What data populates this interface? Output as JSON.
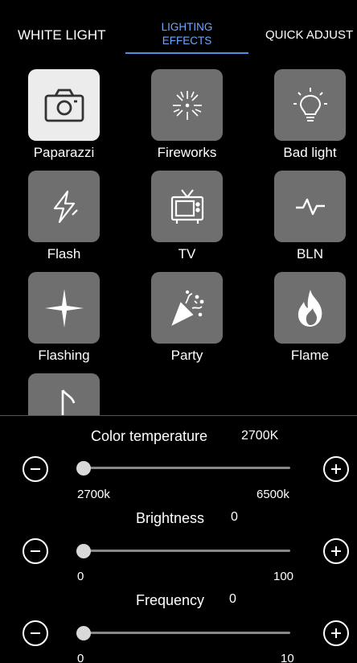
{
  "tabs": {
    "white_light": "WHITE LIGHT",
    "lighting_effects_line1": "LIGHTING",
    "lighting_effects_line2": "EFFECTS",
    "quick_adjust": "QUICK ADJUST",
    "active": "LIGHTING EFFECTS",
    "accent_color": "#4f8fe8"
  },
  "effects": [
    {
      "label": "Paparazzi",
      "icon": "camera-icon",
      "selected": true
    },
    {
      "label": "Fireworks",
      "icon": "fireworks-icon",
      "selected": false
    },
    {
      "label": "Bad light",
      "icon": "lightbulb-icon",
      "selected": false
    },
    {
      "label": "Flash",
      "icon": "lightning-icon",
      "selected": false
    },
    {
      "label": "TV",
      "icon": "tv-icon",
      "selected": false
    },
    {
      "label": "BLN",
      "icon": "pulse-icon",
      "selected": false
    },
    {
      "label": "Flashing",
      "icon": "sparkle-star-icon",
      "selected": false
    },
    {
      "label": "Party",
      "icon": "party-popper-icon",
      "selected": false
    },
    {
      "label": "Flame",
      "icon": "flame-icon",
      "selected": false
    },
    {
      "label": "",
      "icon": "music-note-icon",
      "selected": false
    }
  ],
  "controls": {
    "color_temperature": {
      "title": "Color temperature",
      "value": "2700K",
      "min_label": "2700k",
      "max_label": "6500k",
      "level": 0
    },
    "brightness": {
      "title": "Brightness",
      "value": "0",
      "min_label": "0",
      "max_label": "100",
      "level": 0
    },
    "frequency": {
      "title": "Frequency",
      "value": "0",
      "min_label": "0",
      "max_label": "10",
      "level": 0
    }
  }
}
